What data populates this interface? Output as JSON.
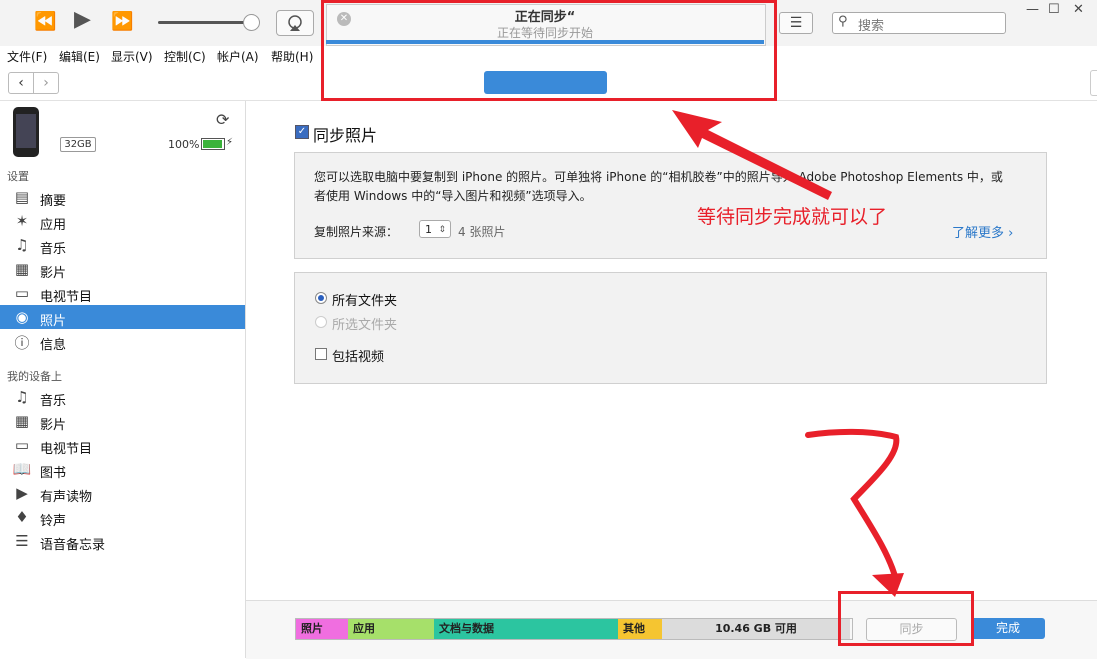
{
  "status": {
    "title": "正在同步“",
    "subtitle": "正在等待同步开始",
    "device_pill": "",
    "close_icon": "close-icon"
  },
  "menu": [
    "文件(F)",
    "编辑(E)",
    "显示(V)",
    "控制(C)",
    "帐户(A)",
    "帮助(H)"
  ],
  "search": {
    "placeholder": "搜索"
  },
  "device": {
    "name": "",
    "capacity": "32GB",
    "battery": "100%",
    "battery_level": 1.0
  },
  "sidebar": {
    "section_settings": "设置",
    "settings_items": [
      {
        "label": "摘要",
        "icon": "summary-icon"
      },
      {
        "label": "应用",
        "icon": "apps-icon"
      },
      {
        "label": "音乐",
        "icon": "music-icon"
      },
      {
        "label": "影片",
        "icon": "film-icon"
      },
      {
        "label": "电视节目",
        "icon": "tv-icon"
      },
      {
        "label": "照片",
        "icon": "camera-icon",
        "active": true
      },
      {
        "label": "信息",
        "icon": "info-icon"
      }
    ],
    "section_mydevice": "我的设备上",
    "device_items": [
      {
        "label": "音乐",
        "icon": "music-icon"
      },
      {
        "label": "影片",
        "icon": "film-icon"
      },
      {
        "label": "电视节目",
        "icon": "tv-icon"
      },
      {
        "label": "图书",
        "icon": "book-icon"
      },
      {
        "label": "有声读物",
        "icon": "audiobook-icon"
      },
      {
        "label": "铃声",
        "icon": "bell-icon"
      },
      {
        "label": "语音备忘录",
        "icon": "voice-memo-icon"
      }
    ]
  },
  "main": {
    "sync_title": "同步照片",
    "description": "您可以选取电脑中要复制到 iPhone 的照片。可单独将 iPhone 的“相机胶卷”中的照片导入 Adobe Photoshop Elements 中，或者使用 Windows 中的“导入图片和视频”选项导入。",
    "source_label": "复制照片来源：",
    "source_value": "1",
    "source_count": "4 张照片",
    "learn_more": "了解更多",
    "opt_all": "所有文件夹",
    "opt_selected": "所选文件夹",
    "opt_video": "包括视频"
  },
  "annotation": {
    "text": "等待同步完成就可以了",
    "scribble_label": "7"
  },
  "footer": {
    "segments": [
      {
        "label": "照片",
        "color": "#f06ee0"
      },
      {
        "label": "应用",
        "color": "#a6e06a"
      },
      {
        "label": "文档与数据",
        "color": "#2cc5a0"
      },
      {
        "label": "其他",
        "color": "#f5c531"
      },
      {
        "label": "10.46 GB 可用",
        "color": "#dcdcdc"
      }
    ],
    "sync_label": "同步",
    "done_label": "完成"
  },
  "colors": {
    "accent": "#3a8ad9",
    "annotation": "#e8202a"
  }
}
